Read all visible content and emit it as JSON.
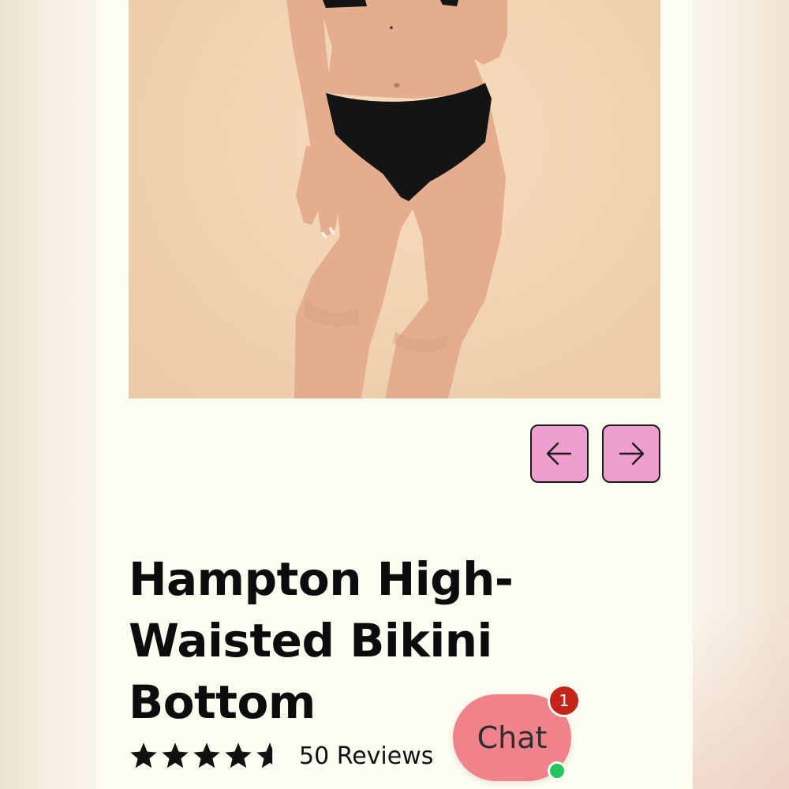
{
  "product": {
    "title": "Hampton High-Waisted Bikini Bottom",
    "rating": 4.5,
    "rating_max": 5,
    "reviews_label": "50 Reviews"
  },
  "gallery": {
    "prev_icon": "arrow-left-icon",
    "next_icon": "arrow-right-icon",
    "button_color": "#ee9fcf"
  },
  "chat": {
    "label": "Chat",
    "badge_count": "1",
    "bubble_color": "#f0828c",
    "badge_color": "#c42519",
    "status_color": "#22c55e"
  },
  "colors": {
    "page_background": "#fdfcf1",
    "star_color": "#111111"
  }
}
